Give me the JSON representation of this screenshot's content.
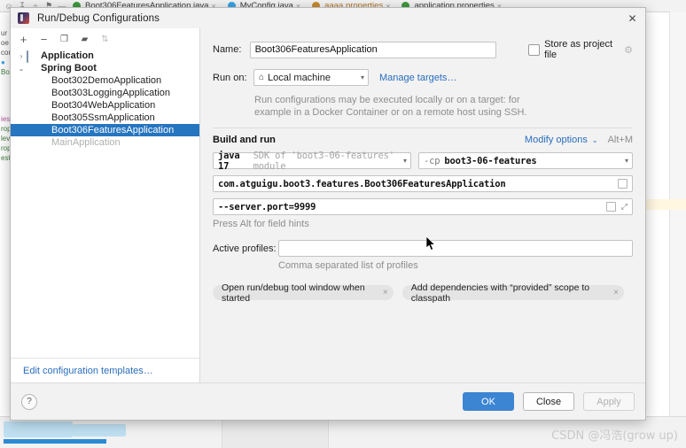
{
  "ide": {
    "tabs": [
      {
        "label": "Boot306FeaturesApplication.java",
        "icon": "java-class-icon",
        "color": "#3d9a3d"
      },
      {
        "label": "MyConfig.java",
        "icon": "java-class-icon",
        "color": "#3aa3e3"
      },
      {
        "label": "aaaa.properties",
        "icon": "properties-file-icon",
        "color": "#c98a2e"
      },
      {
        "label": "application.properties",
        "icon": "properties-file-icon",
        "color": "#3d9a3d"
      }
    ],
    "close_glyph": "×",
    "toolbar_glyphs": [
      "☸",
      "⤓",
      "≡",
      "⌂",
      "—"
    ],
    "gutter_lines": [
      "ur",
      "oe",
      "cor",
      "●",
      "Boo",
      "",
      "ies",
      "rop",
      "lev",
      "rop",
      "est"
    ]
  },
  "dialog": {
    "title": "Run/Debug Configurations",
    "close_glyph": "✕",
    "toolbar": [
      {
        "name": "add-configuration-button",
        "glyph": "+",
        "dim": false
      },
      {
        "name": "remove-configuration-button",
        "glyph": "−",
        "dim": false
      },
      {
        "name": "copy-configuration-button",
        "glyph": "❐",
        "dim": false
      },
      {
        "name": "move-into-folder-button",
        "glyph": "▰",
        "dim": false
      },
      {
        "name": "sort-configurations-button",
        "glyph": "⇅",
        "dim": true
      }
    ],
    "tree": [
      {
        "label": "Application",
        "arrow": "›",
        "icon": "application-folder-icon",
        "bold": true,
        "selected": false,
        "dim": false,
        "child": false
      },
      {
        "label": "Spring Boot",
        "arrow": "⌄",
        "icon": "spring-boot-icon",
        "bold": true,
        "selected": false,
        "dim": false,
        "child": false
      },
      {
        "label": "Boot302DemoApplication",
        "arrow": "",
        "icon": "spring-boot-icon",
        "bold": false,
        "selected": false,
        "dim": false,
        "child": true
      },
      {
        "label": "Boot303LoggingApplication",
        "arrow": "",
        "icon": "spring-boot-icon",
        "bold": false,
        "selected": false,
        "dim": false,
        "child": true
      },
      {
        "label": "Boot304WebApplication",
        "arrow": "",
        "icon": "spring-boot-icon",
        "bold": false,
        "selected": false,
        "dim": false,
        "child": true
      },
      {
        "label": "Boot305SsmApplication",
        "arrow": "",
        "icon": "spring-boot-icon",
        "bold": false,
        "selected": false,
        "dim": false,
        "child": true
      },
      {
        "label": "Boot306FeaturesApplication",
        "arrow": "",
        "icon": "spring-boot-icon",
        "bold": false,
        "selected": true,
        "dim": false,
        "child": true
      },
      {
        "label": "MainApplication",
        "arrow": "",
        "icon": "spring-boot-icon",
        "bold": false,
        "selected": false,
        "dim": true,
        "child": true
      }
    ],
    "edit_templates_link": "Edit configuration templates…",
    "form": {
      "name_label": "Name:",
      "name_value": "Boot306FeaturesApplication",
      "store_as_project_file_label": "Store as project file",
      "store_as_project_file_checked": false,
      "gear_glyph": "⚙",
      "run_on_label": "Run on:",
      "run_on_value": "Local machine",
      "run_on_icon": "⌂",
      "manage_targets_link": "Manage targets…",
      "description_line1": "Run configurations may be executed locally or on a target: for",
      "description_line2": "example in a Docker Container or on a remote host using SSH.",
      "build_and_run_label": "Build and run",
      "modify_options_link": "Modify options",
      "modify_options_caret": "⌄",
      "modify_options_shortcut": "Alt+M",
      "jdk_value": "java 17",
      "jdk_suffix": "SDK of 'boot3-06-features' module",
      "classpath_prefix": "-cp",
      "classpath_value": "boot3-06-features",
      "main_class_value": "com.atguigu.boot3.features.Boot306FeaturesApplication",
      "program_arguments_value": "--server.port=9999",
      "field_hints_text": "Press Alt for field hints",
      "active_profiles_label": "Active profiles:",
      "active_profiles_value": "",
      "active_profiles_hint": "Comma separated list of profiles",
      "caret_glyph": "▾",
      "expand_glyph": "⤢",
      "chips": [
        {
          "label": "Open run/debug tool window when started",
          "close": "×"
        },
        {
          "label": "Add dependencies with “provided” scope to classpath",
          "close": "×"
        }
      ]
    },
    "footer": {
      "help_glyph": "?",
      "ok_label": "OK",
      "close_label": "Close",
      "apply_label": "Apply",
      "apply_disabled": true
    }
  },
  "watermark": "CSDN @冯浩(grow up)",
  "colors": {
    "selection_blue": "#2675bf",
    "primary_button": "#3b85d3",
    "link_blue": "#2a6dbd",
    "dialog_bg": "#f2f2f2"
  }
}
